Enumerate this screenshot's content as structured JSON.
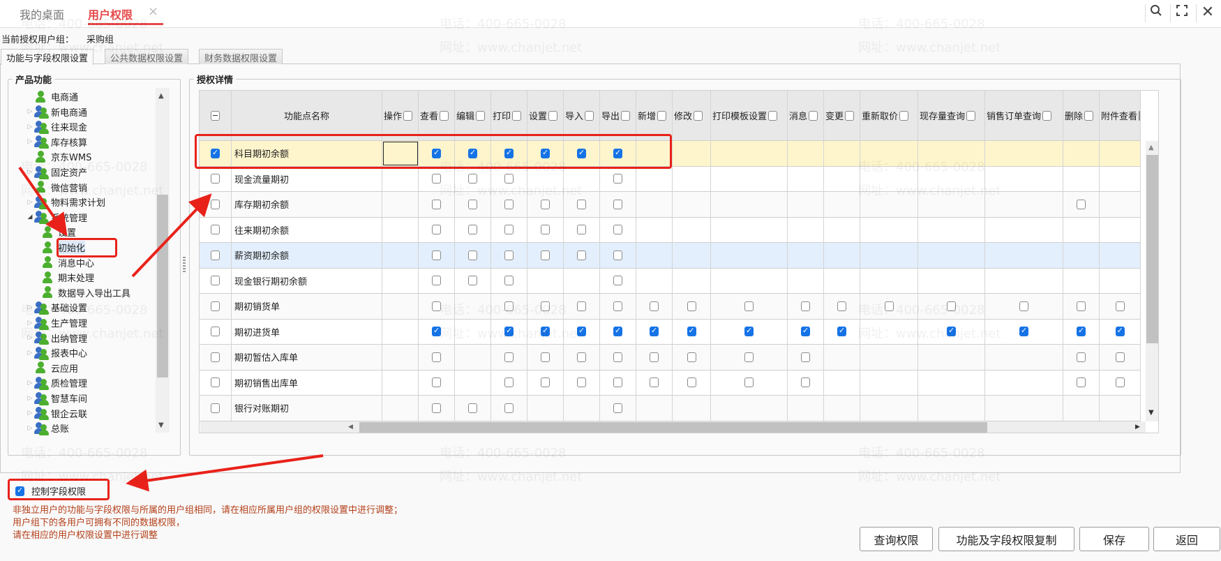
{
  "topbar": {
    "tabs": [
      {
        "label": "我的桌面"
      },
      {
        "label": "用户权限",
        "close": "×"
      }
    ],
    "icons": [
      "search-icon",
      "fullscreen-icon",
      "close-icon"
    ]
  },
  "group": {
    "label": "当前授权用户组：",
    "value": "采购组"
  },
  "subtabs": [
    "功能与字段权限设置",
    "公共数据权限设置",
    "财务数据权限设置"
  ],
  "left": {
    "title": "产品功能",
    "tree": [
      {
        "label": "电商通",
        "level": 0,
        "expander": "none",
        "icon": "user"
      },
      {
        "label": "新电商通",
        "level": 0,
        "expander": "collapsed",
        "icon": "group"
      },
      {
        "label": "往来现金",
        "level": 0,
        "expander": "collapsed",
        "icon": "group"
      },
      {
        "label": "库存核算",
        "level": 0,
        "expander": "collapsed",
        "icon": "group"
      },
      {
        "label": "京东WMS",
        "level": 0,
        "expander": "none",
        "icon": "user"
      },
      {
        "label": "固定资产",
        "level": 0,
        "expander": "collapsed",
        "icon": "group"
      },
      {
        "label": "微信营销",
        "level": 0,
        "expander": "none",
        "icon": "user"
      },
      {
        "label": "物料需求计划",
        "level": 0,
        "expander": "collapsed",
        "icon": "group"
      },
      {
        "label": "系统管理",
        "level": 0,
        "expander": "expanded",
        "icon": "group"
      },
      {
        "label": "设置",
        "level": 1,
        "expander": "none",
        "icon": "user"
      },
      {
        "label": "初始化",
        "level": 1,
        "expander": "none",
        "icon": "user",
        "selected": true
      },
      {
        "label": "消息中心",
        "level": 1,
        "expander": "none",
        "icon": "user"
      },
      {
        "label": "期末处理",
        "level": 1,
        "expander": "none",
        "icon": "user"
      },
      {
        "label": "数据导入导出工具",
        "level": 1,
        "expander": "none",
        "icon": "user"
      },
      {
        "label": "基础设置",
        "level": 0,
        "expander": "collapsed",
        "icon": "group"
      },
      {
        "label": "生产管理",
        "level": 0,
        "expander": "collapsed",
        "icon": "group"
      },
      {
        "label": "出纳管理",
        "level": 0,
        "expander": "collapsed",
        "icon": "group"
      },
      {
        "label": "报表中心",
        "level": 0,
        "expander": "collapsed",
        "icon": "group"
      },
      {
        "label": "云应用",
        "level": 0,
        "expander": "none",
        "icon": "user"
      },
      {
        "label": "质检管理",
        "level": 0,
        "expander": "collapsed",
        "icon": "group"
      },
      {
        "label": "智慧车间",
        "level": 0,
        "expander": "collapsed",
        "icon": "group"
      },
      {
        "label": "银企云联",
        "level": 0,
        "expander": "collapsed",
        "icon": "group"
      },
      {
        "label": "总账",
        "level": 0,
        "expander": "collapsed",
        "icon": "group"
      }
    ]
  },
  "right": {
    "title": "授权详情",
    "name_header": "功能点名称",
    "columns": [
      "操作",
      "查看",
      "编辑",
      "打印",
      "设置",
      "导入",
      "导出",
      "新增",
      "修改",
      "打印模板设置",
      "消息",
      "变更",
      "重新取价",
      "现存量查询",
      "销售订单查询",
      "删除",
      "附件查看"
    ],
    "rows": [
      {
        "checked": true,
        "name": "科目期初余额",
        "cells": [
          null,
          1,
          1,
          1,
          1,
          1,
          1,
          null,
          null,
          null,
          null,
          null,
          null,
          null,
          null,
          null,
          null
        ],
        "highlight": "selected"
      },
      {
        "checked": false,
        "name": "现金流量期初",
        "cells": [
          null,
          0,
          0,
          0,
          null,
          null,
          0,
          null,
          null,
          null,
          null,
          null,
          null,
          null,
          null,
          null,
          null
        ]
      },
      {
        "checked": false,
        "name": "库存期初余额",
        "cells": [
          null,
          0,
          0,
          0,
          0,
          0,
          0,
          null,
          null,
          null,
          null,
          null,
          null,
          null,
          null,
          0,
          null
        ]
      },
      {
        "checked": false,
        "name": "往来期初余额",
        "cells": [
          null,
          0,
          0,
          0,
          0,
          0,
          0,
          null,
          null,
          null,
          null,
          null,
          null,
          null,
          null,
          null,
          null
        ]
      },
      {
        "checked": false,
        "name": "薪资期初余额",
        "cells": [
          null,
          0,
          0,
          0,
          0,
          0,
          0,
          null,
          null,
          null,
          null,
          null,
          null,
          null,
          null,
          null,
          null
        ],
        "highlight": "hover"
      },
      {
        "checked": false,
        "name": "现金银行期初余额",
        "cells": [
          null,
          0,
          0,
          0,
          null,
          null,
          0,
          null,
          null,
          null,
          null,
          null,
          null,
          null,
          null,
          null,
          null
        ]
      },
      {
        "checked": false,
        "name": "期初销货单",
        "cells": [
          null,
          0,
          null,
          0,
          0,
          0,
          0,
          0,
          0,
          0,
          0,
          0,
          0,
          0,
          0,
          0,
          0
        ]
      },
      {
        "checked": false,
        "name": "期初进货单",
        "cells": [
          null,
          1,
          null,
          1,
          1,
          1,
          1,
          1,
          1,
          1,
          1,
          1,
          null,
          1,
          1,
          1,
          1
        ]
      },
      {
        "checked": false,
        "name": "期初暂估入库单",
        "cells": [
          null,
          0,
          null,
          0,
          0,
          0,
          0,
          0,
          0,
          0,
          0,
          null,
          null,
          null,
          null,
          0,
          0
        ]
      },
      {
        "checked": false,
        "name": "期初销售出库单",
        "cells": [
          null,
          0,
          null,
          0,
          0,
          0,
          0,
          0,
          0,
          0,
          0,
          null,
          null,
          null,
          null,
          0,
          0
        ]
      },
      {
        "checked": false,
        "name": "银行对账期初",
        "cells": [
          null,
          0,
          0,
          0,
          null,
          null,
          0,
          null,
          null,
          null,
          null,
          null,
          null,
          null,
          null,
          null,
          null
        ]
      }
    ]
  },
  "control": {
    "label": "控制字段权限",
    "checked": true
  },
  "notes": [
    "非独立用户的功能与字段权限与所属的用户组相同，请在相应所属用户组的权限设置中进行调整；",
    "用户组下的各用户可拥有不同的数据权限，",
    "请在相应的用户权限设置中进行调整"
  ],
  "buttons": {
    "query": "查询权限",
    "copy": "功能及字段权限复制",
    "save": "保存",
    "back": "返回"
  },
  "watermark": [
    "电话：400-665-0028",
    "网址：www.chanjet.net"
  ],
  "colors": {
    "accent": "#e64a4a",
    "check": "#1673e6",
    "annotation": "#e8221a",
    "selected_row": "#fff5cc",
    "hover_row": "#e3effc"
  }
}
